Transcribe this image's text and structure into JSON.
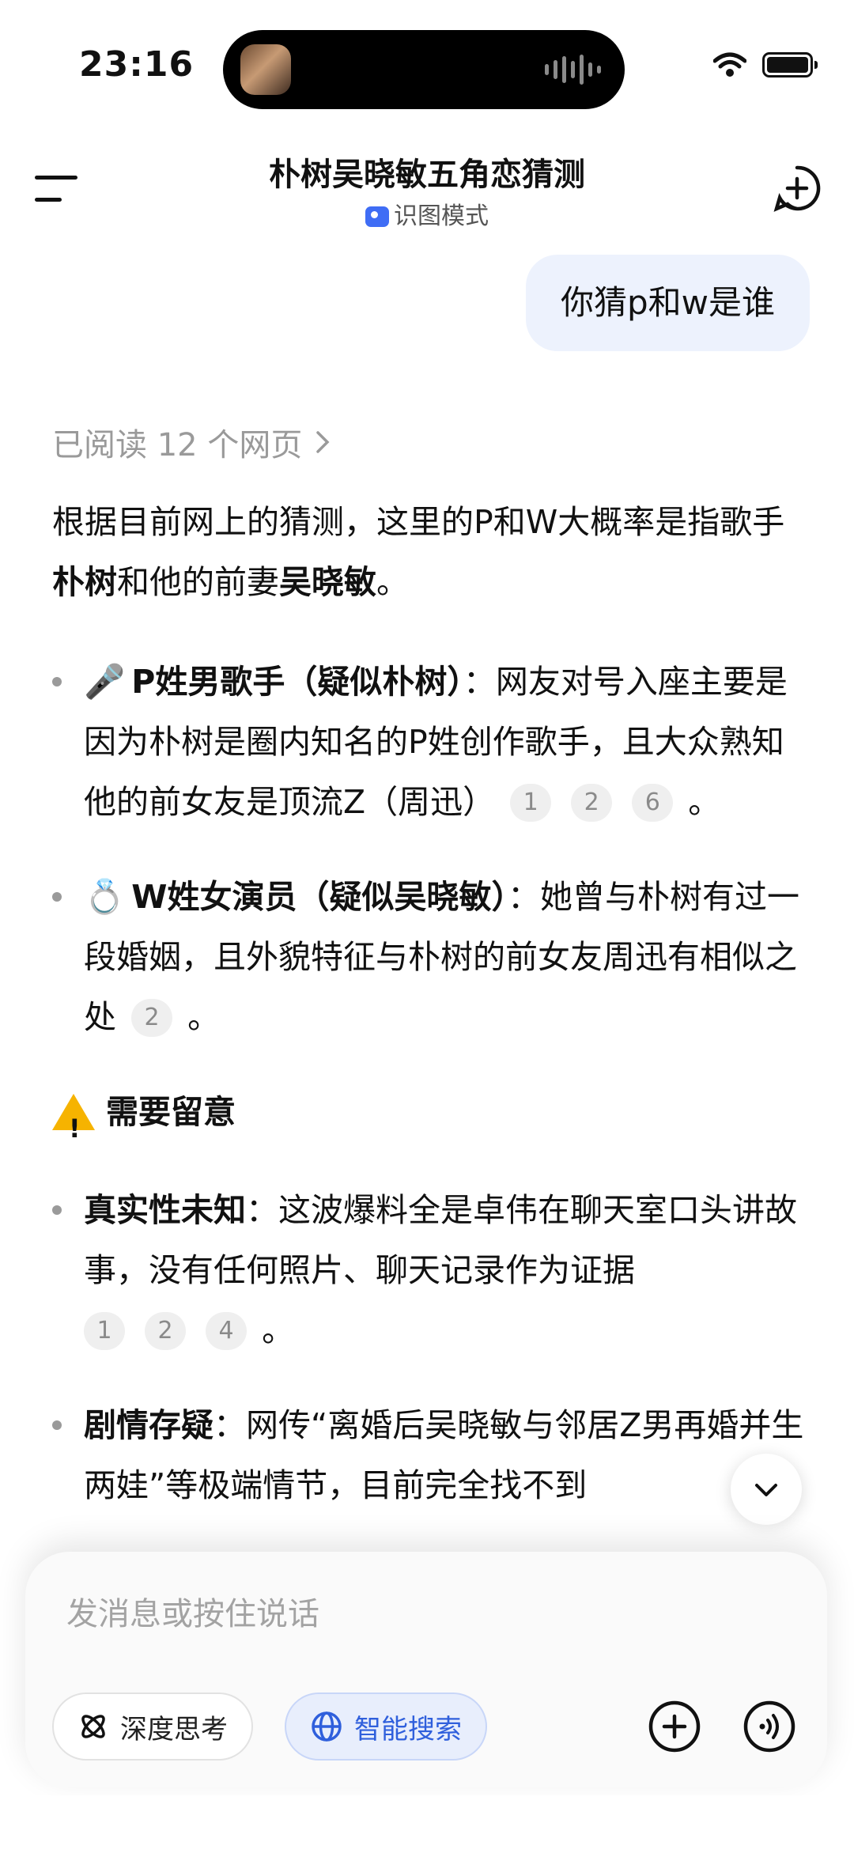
{
  "status_bar": {
    "time": "23:16"
  },
  "header": {
    "title": "朴树吴晓敏五角恋猜测",
    "mode_label": "识图模式"
  },
  "user_message": "你猜p和w是谁",
  "answer": {
    "read_pages": "已阅读 12 个网页",
    "intro_1": "根据目前网上的猜测，这里的P和W大概率是指歌手",
    "intro_bold_1": "朴树",
    "intro_2": "和他的前妻",
    "intro_bold_2": "吴晓敏",
    "intro_3": "。",
    "items": [
      {
        "emoji": "🎤",
        "title": "P姓男歌手（疑似朴树）",
        "text": "：网友对号入座主要是因为朴树是圈内知名的P姓创作歌手，且大众熟知他的前女友是顶流Z（周迅）",
        "cites": [
          "1",
          "2",
          "6"
        ],
        "end": "。"
      },
      {
        "emoji": "💍",
        "title": "W姓女演员（疑似吴晓敏）",
        "text": "：她曾与朴树有过一段婚姻，且外貌特征与朴树的前女友周迅有相似之处",
        "cites": [
          "2"
        ],
        "end": "。"
      }
    ],
    "warning_heading": "需要留意",
    "notes": [
      {
        "title": "真实性未知",
        "text": "：这波爆料全是卓伟在聊天室口头讲故事，没有任何照片、聊天记录作为证据",
        "cites": [
          "1",
          "2",
          "4"
        ],
        "end": "。"
      },
      {
        "title": "剧情存疑",
        "text": "：网传“离婚后吴晓敏与邻居Z男再婚并生两娃”等极端情节，目前完全找不到",
        "cites": [],
        "end": ""
      }
    ]
  },
  "composer": {
    "placeholder": "发消息或按住说话",
    "deep_think_label": "深度思考",
    "smart_search_label": "智能搜索"
  },
  "colors": {
    "accent": "#2f5fdc",
    "bubble": "#edf2fd",
    "warning": "#f6b300"
  }
}
